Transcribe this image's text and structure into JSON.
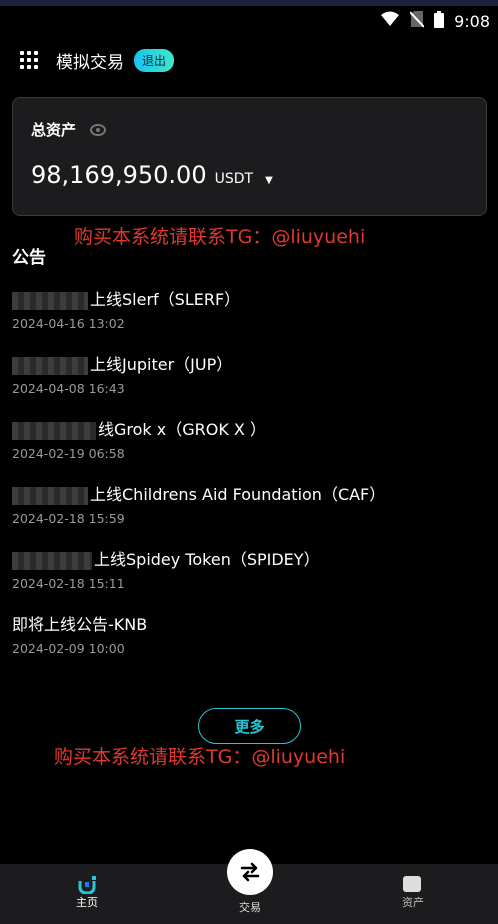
{
  "status": {
    "time": "9:08"
  },
  "header": {
    "title": "模拟交易",
    "exit_label": "退出"
  },
  "card": {
    "label": "总资产",
    "balance": "98,169,950.00",
    "unit": "USDT"
  },
  "watermark": "购买本系统请联系TG：@liuyuehi",
  "announcements": {
    "title": "公告",
    "items": [
      {
        "title": "上线Slerf（SLERF）",
        "date": "2024-04-16 13:02"
      },
      {
        "title": "上线Jupiter（JUP）",
        "date": "2024-04-08 16:43"
      },
      {
        "title": "线Grok x（GROK X ）",
        "date": "2024-02-19 06:58"
      },
      {
        "title": "上线Childrens Aid Foundation（CAF）",
        "date": "2024-02-18 15:59"
      },
      {
        "title": "上线Spidey Token（SPIDEY）",
        "date": "2024-02-18 15:11"
      },
      {
        "title": "即将上线公告-KNB",
        "date": "2024-02-09 10:00"
      }
    ]
  },
  "more_label": "更多",
  "tabs": {
    "home": "主页",
    "trade": "交易",
    "assets": "资产"
  },
  "colors": {
    "accent": "#25c6d8",
    "watermark": "#e2382f",
    "background": "#000000"
  }
}
